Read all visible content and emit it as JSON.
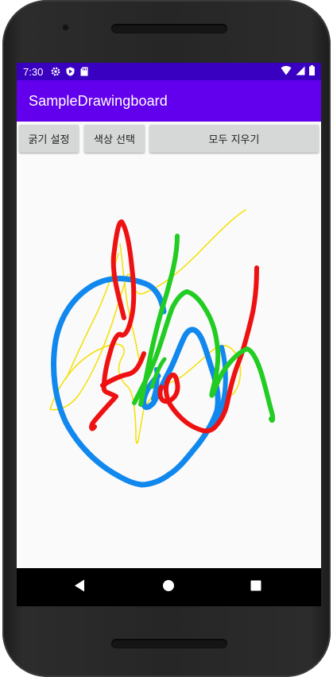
{
  "status_bar": {
    "time": "7:30",
    "left_icons": [
      "gear-icon",
      "play-protect-icon",
      "sd-card-icon"
    ],
    "right_icons": [
      "wifi-icon",
      "signal-icon",
      "battery-icon"
    ]
  },
  "app_bar": {
    "title": "SampleDrawingboard"
  },
  "toolbar": {
    "thickness_label": "굵기 설정",
    "color_label": "색상 선택",
    "clear_label": "모두 지우기"
  },
  "colors": {
    "status_bar": "#3a00c2",
    "app_bar": "#6200ee",
    "canvas_bg": "#fafafa",
    "stroke_blue": "#1188ee",
    "stroke_red": "#ee1111",
    "stroke_green": "#22cc22",
    "stroke_yellow": "#f5e000"
  },
  "navigation": {
    "icons": [
      "back-icon",
      "home-icon",
      "recents-icon"
    ]
  }
}
